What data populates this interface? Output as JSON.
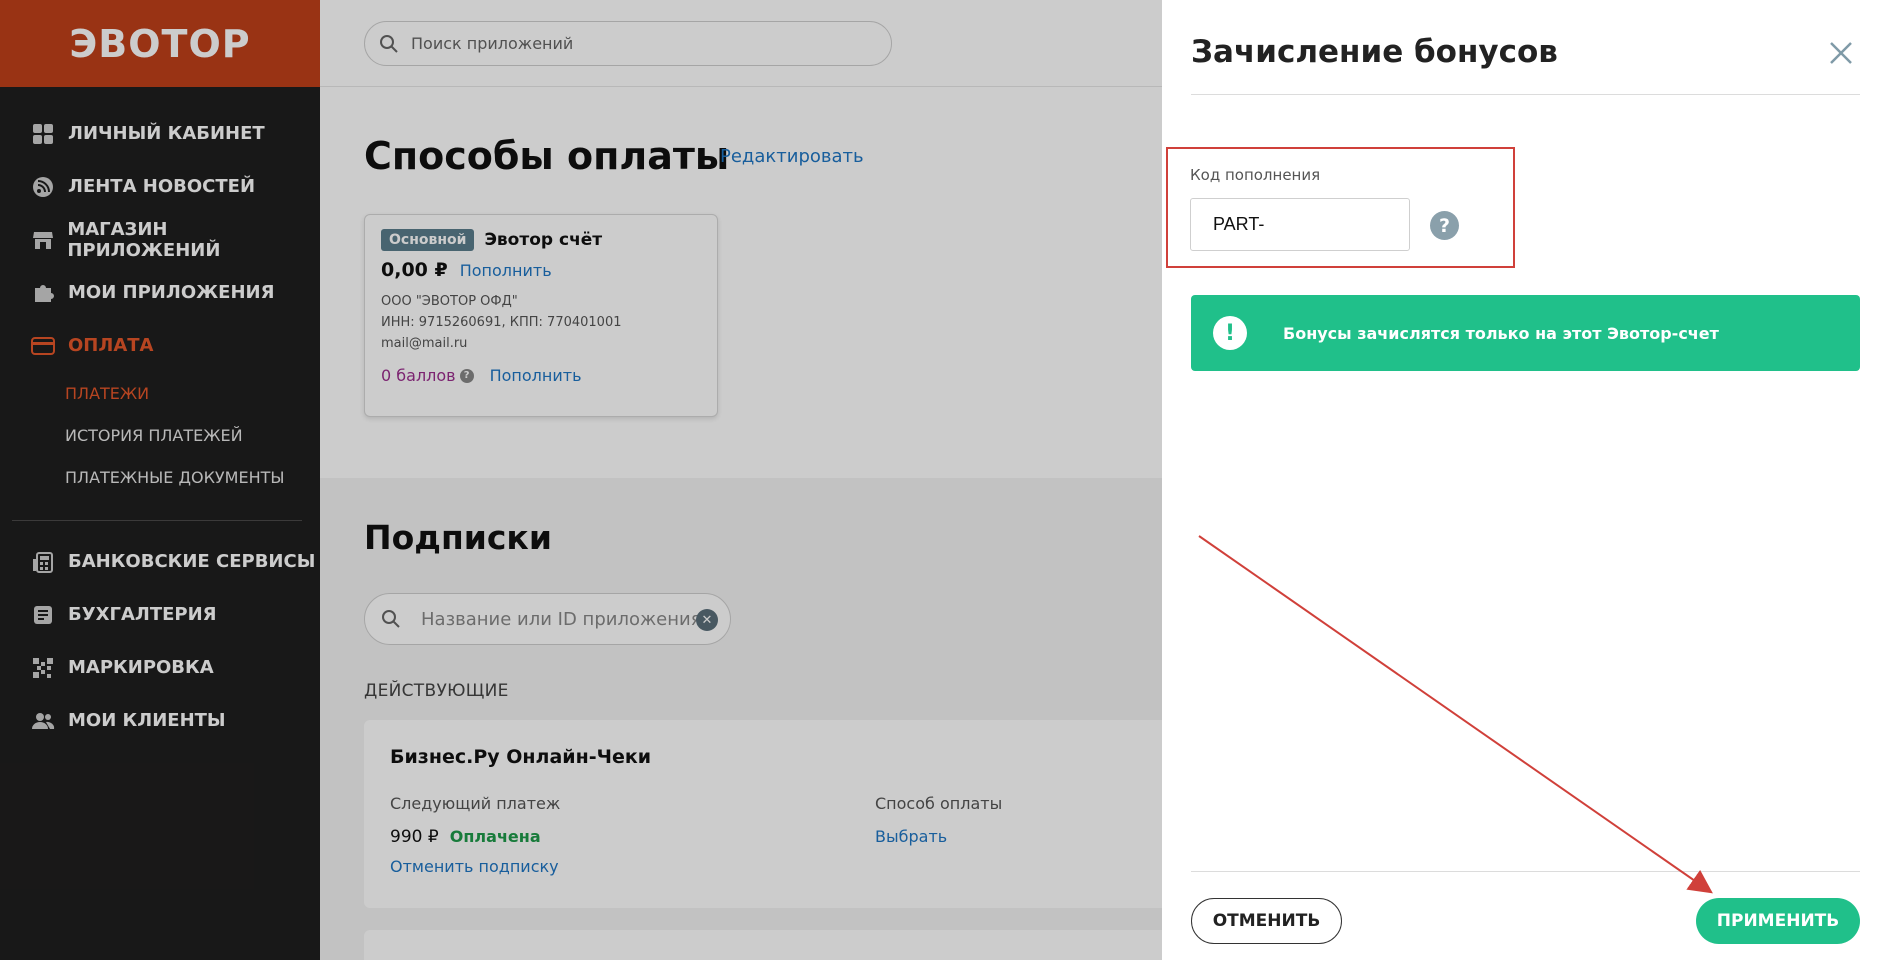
{
  "brand": {
    "logo": "ЭВОТОР"
  },
  "sidebar": {
    "items": [
      {
        "label": "ЛИЧНЫЙ КАБИНЕТ"
      },
      {
        "label": "ЛЕНТА НОВОСТЕЙ"
      },
      {
        "label": "МАГАЗИН ПРИЛОЖЕНИЙ"
      },
      {
        "label": "МОИ ПРИЛОЖЕНИЯ"
      },
      {
        "label": "ОПЛАТА"
      }
    ],
    "subitems": [
      {
        "label": "ПЛАТЕЖИ"
      },
      {
        "label": "ИСТОРИЯ ПЛАТЕЖЕЙ"
      },
      {
        "label": "ПЛАТЕЖНЫЕ ДОКУМЕНТЫ"
      }
    ],
    "items2": [
      {
        "label": "БАНКОВСКИЕ СЕРВИСЫ"
      },
      {
        "label": "БУХГАЛТЕРИЯ"
      },
      {
        "label": "МАРКИРОВКА"
      },
      {
        "label": "МОИ КЛИЕНТЫ"
      }
    ]
  },
  "topbar": {
    "search_placeholder": "Поиск приложений"
  },
  "payment": {
    "title": "Способы оплаты",
    "edit_link": "Редактировать",
    "card": {
      "badge": "Основной",
      "name": "Эвотор счёт",
      "amount": "0,00 ₽",
      "topup": "Пополнить",
      "company": "ООО \"ЭВОТОР ОФД\"",
      "inn": "ИНН: 9715260691, КПП: 770401001",
      "email": "mail@mail.ru",
      "points": "0 баллов",
      "points_topup": "Пополнить"
    }
  },
  "subscriptions": {
    "title": "Подписки",
    "search_placeholder": "Название или ID приложения",
    "active_label": "ДЕЙСТВУЮЩИЕ",
    "card": {
      "name": "Бизнес.Ру Онлайн-Чеки",
      "next_payment_label": "Следующий платеж",
      "price": "990 ₽",
      "status": "Оплачена",
      "cancel_link": "Отменить подписку",
      "method_label": "Способ оплаты",
      "method_link": "Выбрать"
    }
  },
  "drawer": {
    "title": "Зачисление бонусов",
    "field_label": "Код пополнения",
    "field_value": "PART-",
    "notice": "Бонусы зачислятся только на этот Эвотор-счет",
    "cancel_button": "ОТМЕНИТЬ",
    "apply_button": "ПРИМЕНИТЬ"
  },
  "colors": {
    "brand": "#c0401a",
    "accent_active": "#e5572a",
    "success": "#20c08a",
    "link": "#1f76c4",
    "highlight_box": "#d0403a"
  }
}
